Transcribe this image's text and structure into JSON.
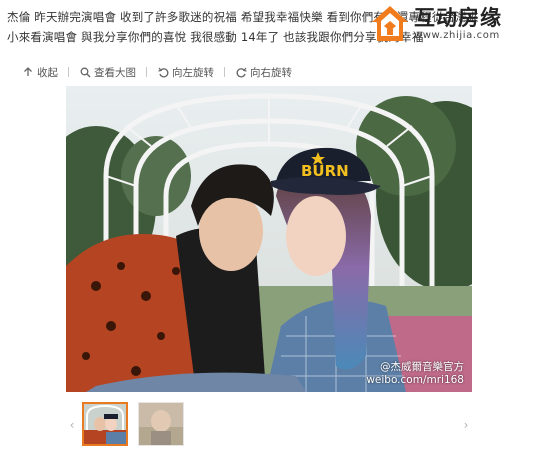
{
  "post": {
    "line1": "杰倫 昨天辦完演唱會 收到了許多歌迷的祝福 希望我幸福快樂 看到你們有些還專程從台灣來",
    "line2": "小來看演唱會 與我分享你們的喜悅 我很感動 14年了 也該我跟你們分享我的幸福"
  },
  "watermark": {
    "brand_name": "互动房缘",
    "url": "www.zhijia.com"
  },
  "toolbar": {
    "collapse_label": "收起",
    "view_large_label": "查看大图",
    "rotate_left_label": "向左旋转",
    "rotate_right_label": "向右旋转"
  },
  "photo": {
    "cap_text": "BURN",
    "credit_line1": "@杰威爾音樂官方",
    "credit_line2": "weibo.com/mri168"
  },
  "colors": {
    "accent": "#e87a20",
    "logo_orange": "#f07c1e",
    "text": "#333333",
    "toolbar_text": "#555555"
  }
}
